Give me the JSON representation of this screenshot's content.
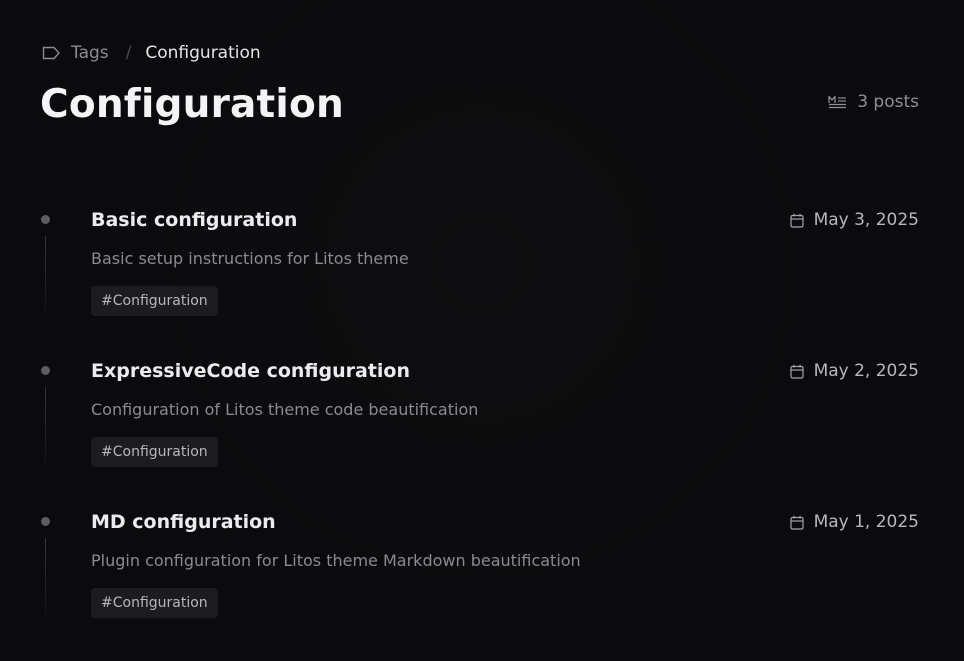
{
  "breadcrumb": {
    "parent_label": "Tags",
    "separator": "/",
    "current_label": "Configuration"
  },
  "header": {
    "title": "Configuration",
    "post_count": "3 posts"
  },
  "posts": [
    {
      "title": "Basic configuration",
      "date": "May 3, 2025",
      "description": "Basic setup instructions for Litos theme",
      "tag": "#Configuration"
    },
    {
      "title": "ExpressiveCode configuration",
      "date": "May 2, 2025",
      "description": "Configuration of Litos theme code beautification",
      "tag": "#Configuration"
    },
    {
      "title": "MD configuration",
      "date": "May 1, 2025",
      "description": "Plugin configuration for Litos theme Markdown beautification",
      "tag": "#Configuration"
    }
  ],
  "icons": {
    "breadcrumb": "tag-icon",
    "count": "markdown-icon",
    "date": "calendar-icon"
  },
  "colors": {
    "background": "#0b0b0d",
    "title": "#f4f4f6",
    "muted": "#8a8a92",
    "chip_bg": "#1c1c20"
  }
}
